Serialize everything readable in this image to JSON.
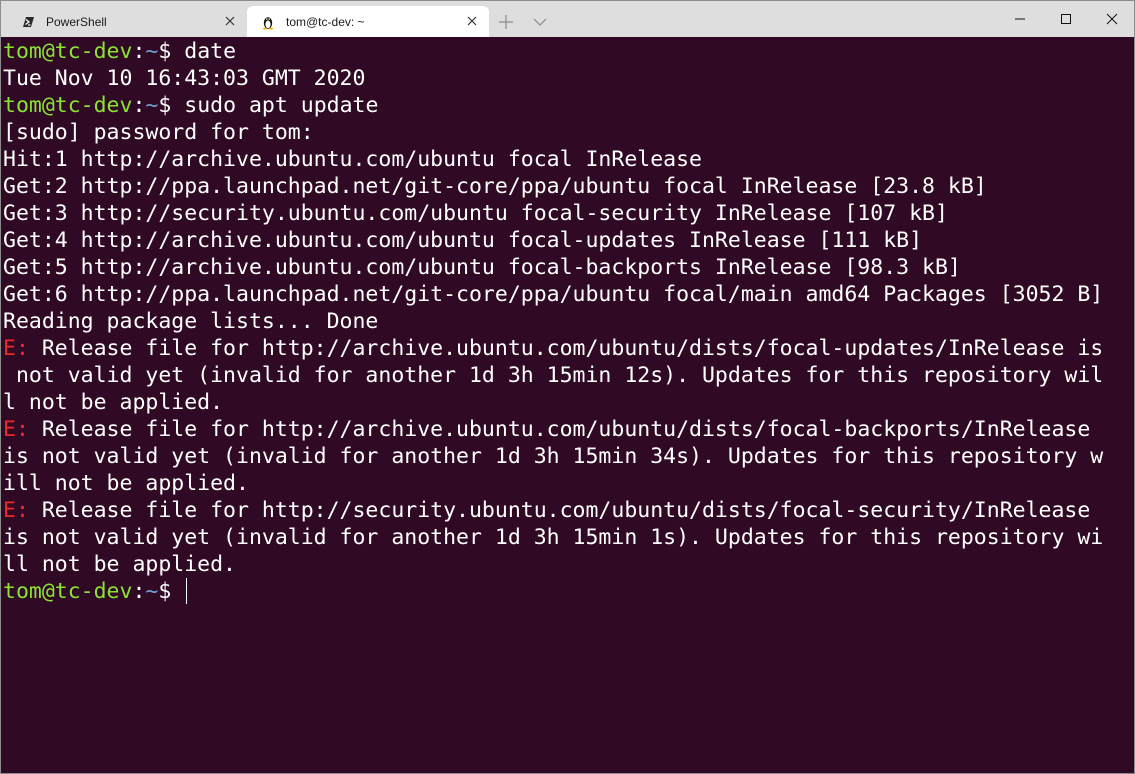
{
  "tabs": [
    {
      "label": "PowerShell",
      "icon": "powershell-icon",
      "active": false
    },
    {
      "label": "tom@tc-dev: ~",
      "icon": "linux-penguin-icon",
      "active": true
    }
  ],
  "titlebar": {
    "new_tab_icon": "plus-icon",
    "dropdown_icon": "chevron-down-icon",
    "minimize_icon": "minimize-icon",
    "maximize_icon": "maximize-icon",
    "close_icon": "close-icon"
  },
  "colors": {
    "terminal_bg": "#300a24",
    "prompt_user": "#8ae234",
    "prompt_path": "#729fcf",
    "error": "#ef2929",
    "text": "#ffffff"
  },
  "terminal": {
    "prompt_user": "tom@tc-dev",
    "prompt_sep": ":",
    "prompt_path": "~",
    "prompt_symbol": "$ ",
    "cmd1": "date",
    "out_date": "Tue Nov 10 16:43:03 GMT 2020",
    "cmd2": "sudo apt update",
    "sudo": "[sudo] password for tom:",
    "hit1": "Hit:1 http://archive.ubuntu.com/ubuntu focal InRelease",
    "get2": "Get:2 http://ppa.launchpad.net/git-core/ppa/ubuntu focal InRelease [23.8 kB]",
    "get3": "Get:3 http://security.ubuntu.com/ubuntu focal-security InRelease [107 kB]",
    "get4": "Get:4 http://archive.ubuntu.com/ubuntu focal-updates InRelease [111 kB]",
    "get5": "Get:5 http://archive.ubuntu.com/ubuntu focal-backports InRelease [98.3 kB]",
    "get6": "Get:6 http://ppa.launchpad.net/git-core/ppa/ubuntu focal/main amd64 Packages [3052 B]",
    "reading": "Reading package lists... Done",
    "err_prefix": "E:",
    "err1_a": " Release file for http://archive.ubuntu.com/ubuntu/dists/focal-updates/InRelease is",
    "err1_b": " not valid yet (invalid for another 1d 3h 15min 12s). Updates for this repository wil",
    "err1_c": "l not be applied.",
    "err2_a": " Release file for http://archive.ubuntu.com/ubuntu/dists/focal-backports/InRelease",
    "err2_b": "is not valid yet (invalid for another 1d 3h 15min 34s). Updates for this repository w",
    "err2_c": "ill not be applied.",
    "err3_a": " Release file for http://security.ubuntu.com/ubuntu/dists/focal-security/InRelease",
    "err3_b": "is not valid yet (invalid for another 1d 3h 15min 1s). Updates for this repository wi",
    "err3_c": "ll not be applied."
  }
}
